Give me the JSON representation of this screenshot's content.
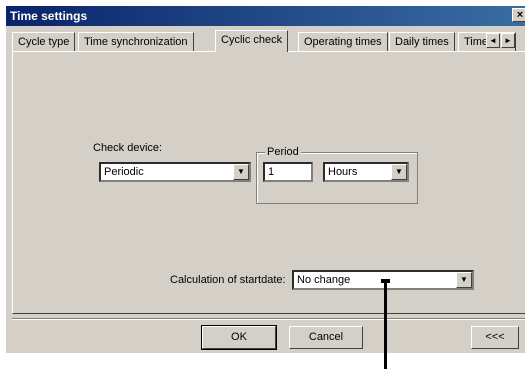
{
  "window": {
    "title": "Time settings",
    "close_glyph": "×"
  },
  "tabs": [
    {
      "label": "Cycle type"
    },
    {
      "label": "Time synchronization"
    },
    {
      "label": "Cyclic check",
      "active": true
    },
    {
      "label": "Operating times"
    },
    {
      "label": "Daily times"
    },
    {
      "label": "Time"
    }
  ],
  "tab_scroll": {
    "left_glyph": "◄",
    "right_glyph": "►"
  },
  "check_device": {
    "label": "Check device:",
    "value": "Periodic"
  },
  "period": {
    "legend": "Period",
    "amount": "1",
    "unit": "Hours"
  },
  "startdate": {
    "label": "Calculation of startdate:",
    "value": "No change"
  },
  "buttons": {
    "ok": "OK",
    "cancel": "Cancel",
    "more": "<<<"
  },
  "icons": {
    "dropdown": "dropdown-arrow-icon"
  }
}
